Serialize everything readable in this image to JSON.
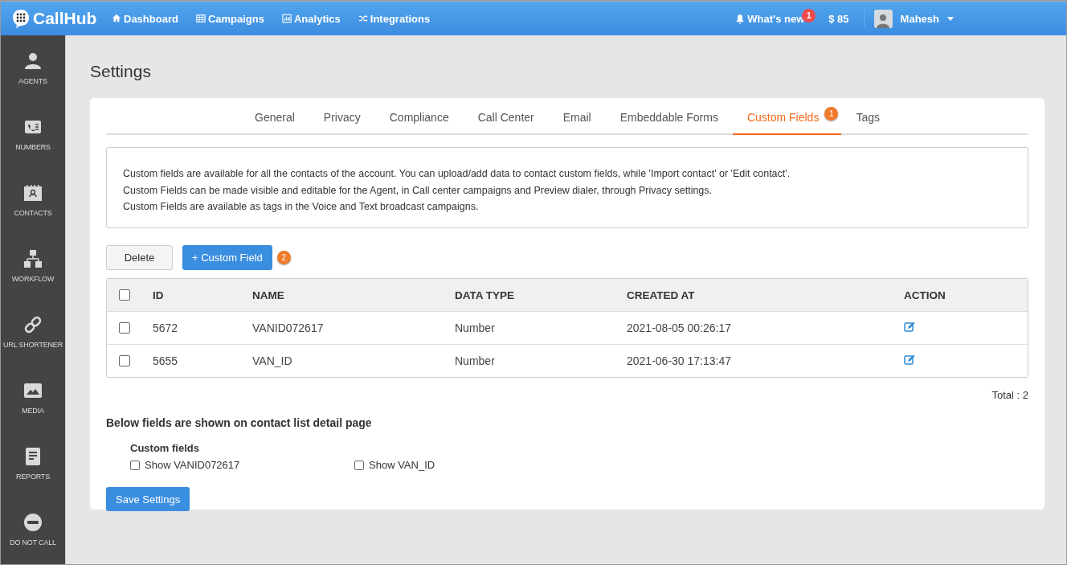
{
  "topbar": {
    "logo": "CallHub",
    "nav": [
      {
        "label": "Dashboard"
      },
      {
        "label": "Campaigns"
      },
      {
        "label": "Analytics"
      },
      {
        "label": "Integrations"
      }
    ],
    "whats_new": {
      "label": "What's new",
      "badge": "1"
    },
    "balance": "$ 85",
    "user": "Mahesh"
  },
  "sidebar": {
    "items": [
      {
        "label": "AGENTS"
      },
      {
        "label": "NUMBERS"
      },
      {
        "label": "CONTACTS"
      },
      {
        "label": "WORKFLOW"
      },
      {
        "label": "URL SHORTENER"
      },
      {
        "label": "MEDIA"
      },
      {
        "label": "REPORTS"
      },
      {
        "label": "DO NOT CALL"
      }
    ]
  },
  "page_title": "Settings",
  "tabs": [
    {
      "label": "General",
      "selected": false
    },
    {
      "label": "Privacy",
      "selected": false
    },
    {
      "label": "Compliance",
      "selected": false
    },
    {
      "label": "Call Center",
      "selected": false
    },
    {
      "label": "Email",
      "selected": false
    },
    {
      "label": "Embeddable Forms",
      "selected": false
    },
    {
      "label": "Custom Fields",
      "selected": true,
      "badge": "1"
    },
    {
      "label": "Tags",
      "selected": false
    }
  ],
  "info": [
    "Custom fields are available for all the contacts of the account. You can upload/add data to contact custom fields, while 'Import contact' or 'Edit contact'.",
    "Custom Fields can be made visible and editable for the Agent, in Call center campaigns and Preview dialer, through Privacy settings.",
    "Custom Fields are available as tags in the Voice and Text broadcast campaigns."
  ],
  "buttons": {
    "delete": "Delete",
    "add": "+ Custom Field",
    "add_badge": "2"
  },
  "table": {
    "select_all": false,
    "columns": [
      "ID",
      "NAME",
      "DATA TYPE",
      "CREATED AT",
      "ACTION"
    ],
    "rows": [
      {
        "checked": false,
        "id": "5672",
        "name": "VANID072617",
        "data_type": "Number",
        "created_at": "2021-08-05 00:26:17"
      },
      {
        "checked": false,
        "id": "5655",
        "name": "VAN_ID",
        "data_type": "Number",
        "created_at": "2021-06-30 17:13:47"
      }
    ]
  },
  "total": "Total : 2",
  "detail": {
    "heading": "Below fields are shown on contact list detail page",
    "subheading": "Custom fields",
    "options": [
      {
        "label": "Show VANID072617",
        "checked": false
      },
      {
        "label": "Show VAN_ID",
        "checked": false
      }
    ]
  },
  "save": "Save Settings"
}
